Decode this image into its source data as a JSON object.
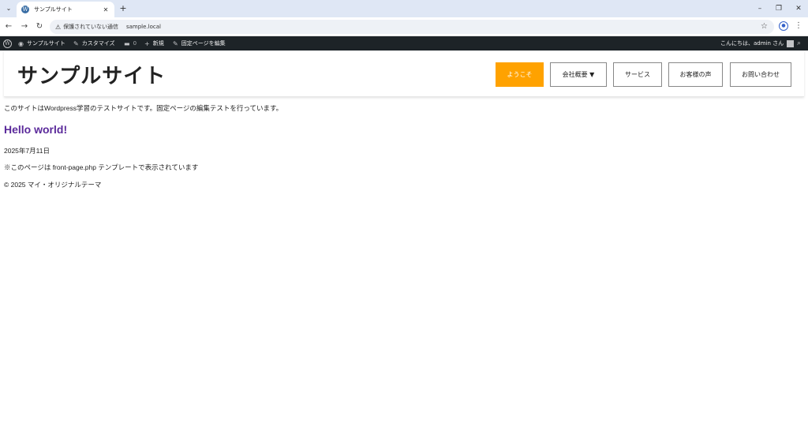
{
  "browser": {
    "tab_title": "サンプルサイト",
    "tab_close": "✕",
    "new_tab": "+",
    "security_label": "保護されていない通信",
    "url": "sample.local"
  },
  "adminbar": {
    "site_name": "サンプルサイト",
    "customize": "カスタマイズ",
    "comments_count": "0",
    "new_label": "新規",
    "edit_page": "固定ページを編集",
    "greeting": "こんにちは、admin さん"
  },
  "header": {
    "site_title": "サンプルサイト",
    "nav": [
      {
        "label": "ようこそ",
        "active": true
      },
      {
        "label": "会社概要 ▼",
        "active": false
      },
      {
        "label": "サービス",
        "active": false
      },
      {
        "label": "お客様の声",
        "active": false
      },
      {
        "label": "お問い合わせ",
        "active": false
      }
    ]
  },
  "content": {
    "intro": "このサイトはWordpress学習のテストサイトです。固定ページの編集テストを行っています。",
    "post_title": "Hello world!",
    "post_date": "2025年7月11日",
    "template_note": "※このページは front-page.php テンプレートで表示されています",
    "footer": "© 2025 マイ・オリジナルテーマ"
  },
  "colors": {
    "accent_nav": "#ffa200",
    "post_title": "#5b2a9b",
    "adminbar_bg": "#1d2327"
  }
}
